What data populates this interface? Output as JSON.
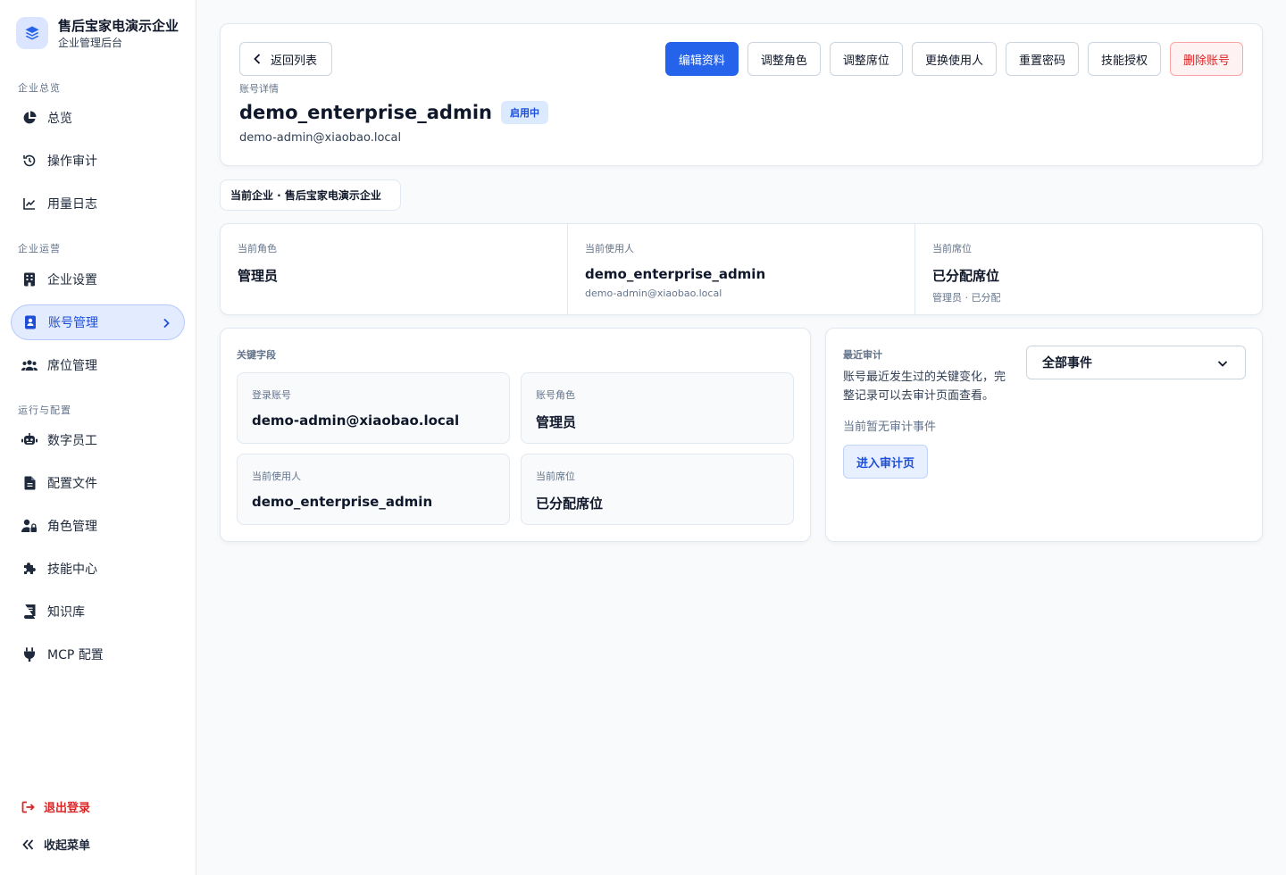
{
  "brand": {
    "title": "售后宝家电演示企业",
    "subtitle": "企业管理后台",
    "logo_icon": "layers-icon"
  },
  "sidebar": {
    "sections": [
      {
        "label": "企业总览",
        "items": [
          {
            "label": "总览",
            "icon": "pie-chart-icon"
          },
          {
            "label": "操作审计",
            "icon": "history-icon"
          },
          {
            "label": "用量日志",
            "icon": "line-chart-icon"
          }
        ]
      },
      {
        "label": "企业运营",
        "items": [
          {
            "label": "企业设置",
            "icon": "building-icon"
          },
          {
            "label": "账号管理",
            "icon": "id-badge-icon",
            "active": true
          },
          {
            "label": "席位管理",
            "icon": "users-icon"
          }
        ]
      },
      {
        "label": "运行与配置",
        "items": [
          {
            "label": "数字员工",
            "icon": "robot-icon"
          },
          {
            "label": "配置文件",
            "icon": "file-icon"
          },
          {
            "label": "角色管理",
            "icon": "user-lock-icon"
          },
          {
            "label": "技能中心",
            "icon": "puzzle-icon"
          },
          {
            "label": "知识库",
            "icon": "book-icon"
          },
          {
            "label": "MCP 配置",
            "icon": "plug-icon"
          }
        ]
      }
    ],
    "logout": "退出登录",
    "collapse": "收起菜单"
  },
  "header": {
    "back_label": "返回列表",
    "actions": {
      "edit": "编辑资料",
      "role": "调整角色",
      "seat": "调整席位",
      "user": "更换使用人",
      "password": "重置密码",
      "skills": "技能授权",
      "delete": "删除账号"
    },
    "section_label": "账号详情",
    "account_name": "demo_enterprise_admin",
    "status": "启用中",
    "email": "demo-admin@xiaobao.local"
  },
  "company_chip": "当前企业 · 售后宝家电演示企业",
  "summary": {
    "role": {
      "label": "当前角色",
      "value": "管理员"
    },
    "user": {
      "label": "当前使用人",
      "value": "demo_enterprise_admin",
      "sub": "demo-admin@xiaobao.local"
    },
    "seat": {
      "label": "当前席位",
      "value": "已分配席位",
      "sub": "管理员 · 已分配"
    }
  },
  "fields": {
    "title": "关键字段",
    "login": {
      "label": "登录账号",
      "value": "demo-admin@xiaobao.local"
    },
    "role": {
      "label": "账号角色",
      "value": "管理员"
    },
    "user": {
      "label": "当前使用人",
      "value": "demo_enterprise_admin"
    },
    "seat": {
      "label": "当前席位",
      "value": "已分配席位"
    }
  },
  "audit": {
    "title": "最近审计",
    "description": "账号最近发生过的关键变化，完整记录可以去审计页面查看。",
    "empty": "当前暂无审计事件",
    "button": "进入审计页",
    "filter_value": "全部事件"
  },
  "colors": {
    "accent": "#2563eb",
    "danger": "#dc2626",
    "active_bg": "#e3ebff"
  }
}
